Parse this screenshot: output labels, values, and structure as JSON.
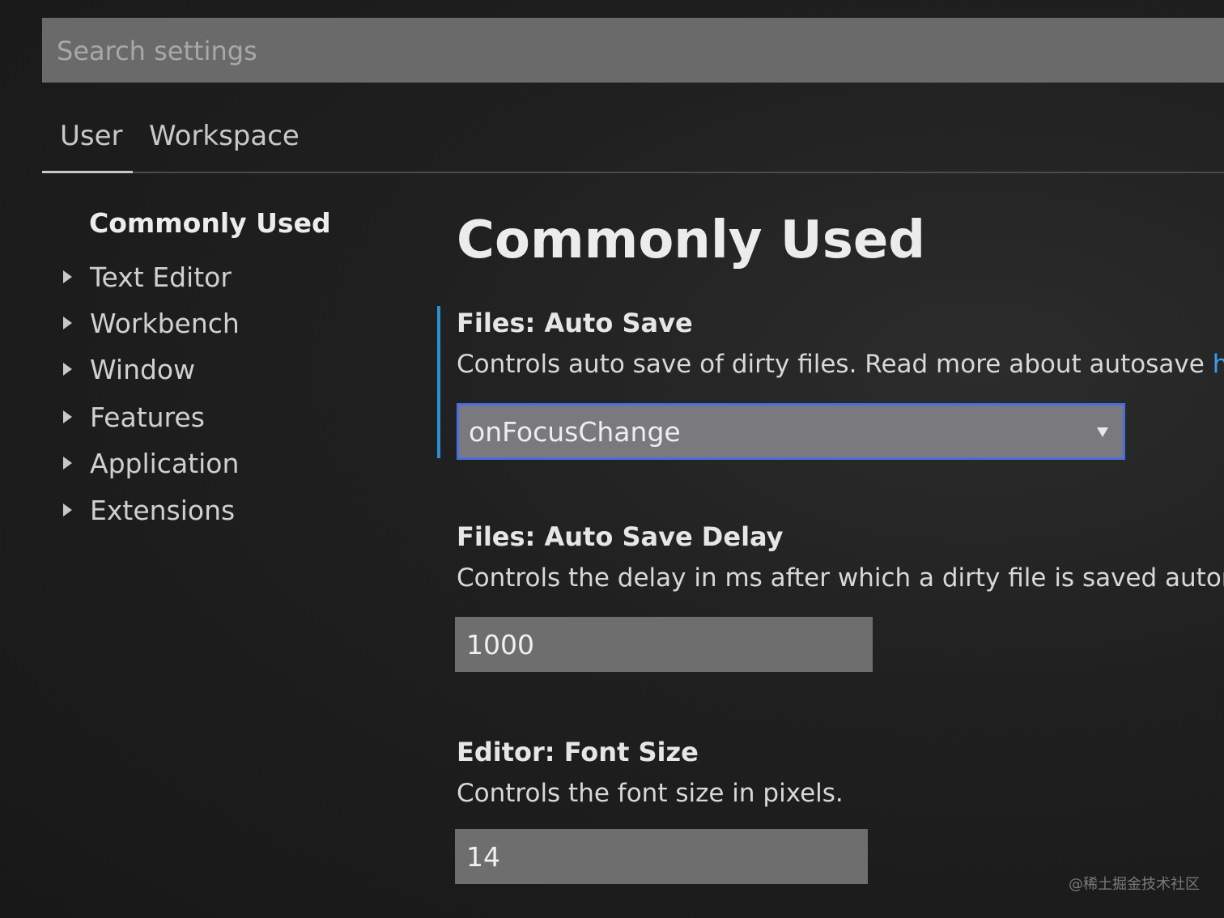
{
  "search": {
    "placeholder": "Search settings",
    "value": ""
  },
  "tabs": [
    {
      "label": "User",
      "active": true
    },
    {
      "label": "Workspace",
      "active": false
    }
  ],
  "toc": {
    "heading": "Commonly Used",
    "items": [
      {
        "label": "Text Editor",
        "icon": "caret-right-icon"
      },
      {
        "label": "Workbench",
        "icon": "caret-right-icon"
      },
      {
        "label": "Window",
        "icon": "caret-right-icon"
      },
      {
        "label": "Features",
        "icon": "caret-right-icon"
      },
      {
        "label": "Application",
        "icon": "caret-right-icon"
      },
      {
        "label": "Extensions",
        "icon": "caret-right-icon"
      }
    ]
  },
  "main": {
    "title": "Commonly Used",
    "settings": [
      {
        "category": "Files: ",
        "name": "Auto Save",
        "description": "Controls auto save of dirty files. Read more about autosave ",
        "link": "here",
        "control": "select",
        "value": "onFocusChange",
        "focused": true
      },
      {
        "category": "Files: ",
        "name": "Auto Save Delay",
        "description": "Controls the delay in ms after which a dirty file is saved automati",
        "control": "number",
        "value": "1000"
      },
      {
        "category": "Editor: ",
        "name": "Font Size",
        "description": "Controls the font size in pixels.",
        "control": "number",
        "value": "14"
      }
    ]
  },
  "watermark": "@稀土掘金技术社区",
  "colors": {
    "focus_accent": "#2b8fd6",
    "link": "#3a9df0",
    "select_border": "#4a6ee0"
  }
}
